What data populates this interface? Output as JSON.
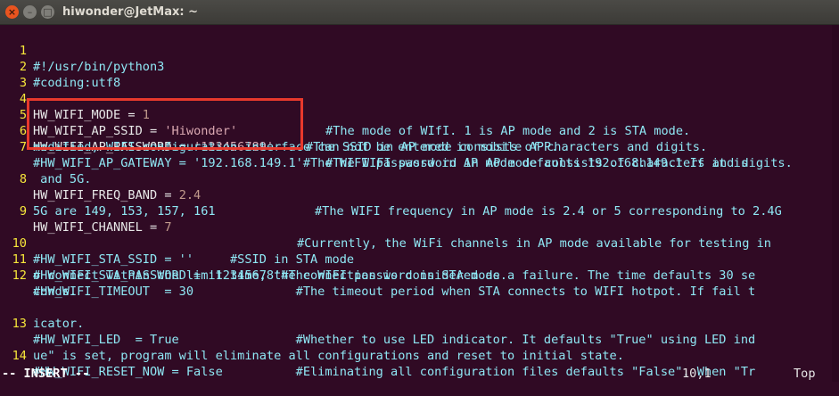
{
  "window": {
    "title": "hiwonder@JetMax: ~",
    "close_glyph": "×",
    "minimize_glyph": "–",
    "maximize_glyph": "□"
  },
  "lines": [
    {
      "num": "1",
      "code": "#!/usr/bin/python3"
    },
    {
      "num": "2",
      "code": "#coding:utf8"
    },
    {
      "num": "3",
      "code": ""
    },
    {
      "num": "4",
      "key": "HW_WIFI_MODE = ",
      "value": "1",
      "comment": "#The mode of WIfI. 1 is AP mode and 2 is STA mode."
    },
    {
      "num": "5",
      "key": "HW_WIFI_AP_SSID = ",
      "value": "'Hiwonder'",
      "comment": "#The SSID in AP mode consists of characters and digits."
    },
    {
      "num": "6",
      "key": "HW_WIFI_AP_PASSWORD = ",
      "value": "'123456789'",
      "comment": "#The WIFI password in AP mode consists of characters and digits."
    },
    {
      "num": "7",
      "code": "#HW_WIFI_AP_GATEWAY = '192.168.149.1'#The WIFI password in AP mode defaults 192.168.149.1 If it is",
      "cont": "modified, WIFI configuration interface can not be entered in mobile APP."
    },
    {
      "num": "8",
      "key": "HW_WIFI_FREQ_BAND = ",
      "value": "2.4",
      "comment": "#The WIFI frequency in AP mode is 2.4 or 5 corresponding to 2.4G",
      "cont": " and 5G."
    },
    {
      "num": "9",
      "key": "HW_WIFI_CHANNEL = ",
      "value": "7",
      "comment": "#Currently, the WiFi channels in AP mode available for testing in",
      "cont": "5G are 149, 153, 157, 161"
    },
    {
      "num": "10",
      "code": "#HW_WIFI_STA_SSID = ''     #SSID in STA mode"
    },
    {
      "num": "11",
      "code": "#HW_WIFI_STA_PASSWORD = '12345678'#The WIFI password in STA mode."
    },
    {
      "num": "12",
      "code": "#HW_WIFI_TIMEOUT  = 30              #The timeout period when STA connects to WIFI hotpot. If fail t",
      "cont": "o connect within the limit time, the connection is considered as a failure. The time defaults 30 se",
      "cont2": "conds."
    },
    {
      "num": "13",
      "code": "#HW_WIFI_LED  = True                #Whether to use LED indicator. It defaults \"True\" using LED ind",
      "cont": "icator."
    },
    {
      "num": "14",
      "code": "#HW_WIFI_RESET_NOW = False          #Eliminating all configuration files defaults \"False\". When \"Tr",
      "cont": "ue\" is set, program will eliminate all configurations and reset to initial state."
    }
  ],
  "status": {
    "mode": "-- INSERT --",
    "position": "10,1",
    "scroll": "Top"
  }
}
